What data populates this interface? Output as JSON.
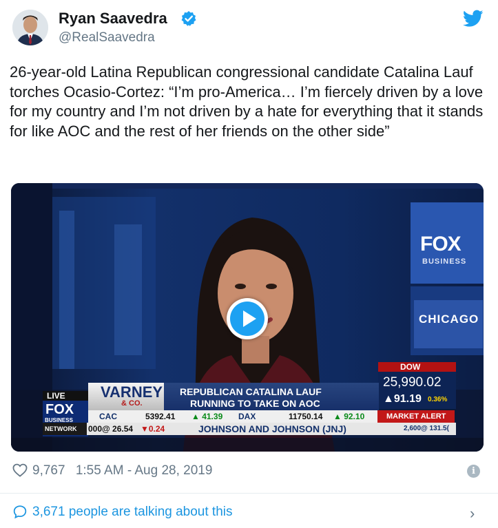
{
  "tweet": {
    "author": {
      "name": "Ryan Saavedra",
      "handle": "@RealSaavedra",
      "verified": true
    },
    "text": "26-year-old Latina Republican congressional candidate Catalina Lauf torches Ocasio-Cortez: “I’m pro-America… I’m fiercely driven by a love for my country and I’m not driven by a hate for everything that it stands for like AOC and the rest of her friends on the other side”",
    "likes": "9,767",
    "timestamp": "1:55 AM - Aug 28, 2019",
    "talking": "3,671 people are talking about this"
  },
  "video": {
    "logo": "FOX",
    "network": "BUSINESS",
    "location": "CHICAGO",
    "live_label": "LIVE",
    "fox_small": "FOX",
    "business_small": "BUSINESS",
    "network_small": "NETWORK",
    "show_name": "VARNEY",
    "show_sub": "& CO.",
    "headline_line1": "REPUBLICAN CATALINA LAUF",
    "headline_line2": "RUNNING TO TAKE ON AOC",
    "index_name": "DOW",
    "index_value": "25,990.02",
    "index_change": "▲91.19",
    "index_pct": "0.36%",
    "ticker_row1": [
      {
        "label": "CAC",
        "value": "5392.41",
        "change": "▲ 41.39",
        "dir": "up"
      },
      {
        "label": "DAX",
        "value": "11750.14",
        "change": "▲ 92.10",
        "dir": "up"
      }
    ],
    "market_alert": "MARKET ALERT",
    "ticker_row2": [
      {
        "text": "000@ 26.54",
        "change": "▼0.24"
      },
      {
        "text": "JOHNSON AND JOHNSON (JNJ)",
        "extra": "2,600@ 131.5("
      }
    ]
  },
  "icons": {
    "verified": "verified-badge-icon",
    "bird": "twitter-bird-icon",
    "play": "play-icon",
    "heart": "heart-icon",
    "info": "info-icon",
    "bubble": "speech-bubble-icon",
    "chevron": "chevron-right-icon"
  },
  "colors": {
    "twitter_blue": "#1da1f2",
    "link_blue": "#1b95e0",
    "muted_gray": "#657786"
  },
  "misc": {
    "info_glyph": "i",
    "chevron_glyph": "›"
  }
}
